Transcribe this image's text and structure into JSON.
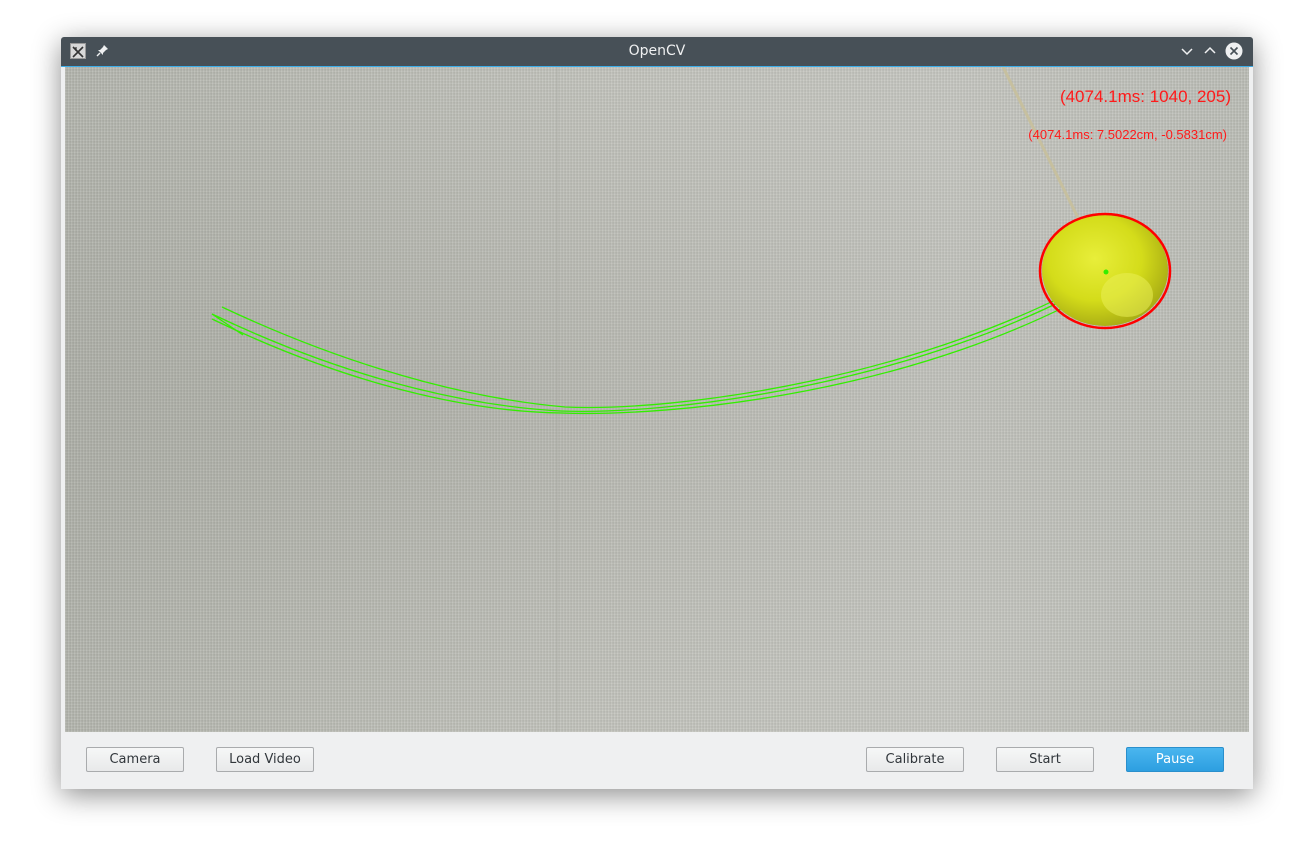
{
  "window": {
    "title": "OpenCV"
  },
  "titlebar": {
    "icons": [
      "app-icon",
      "pin-icon",
      "minimize-chevron-icon",
      "maximize-chevron-icon",
      "close-icon"
    ]
  },
  "overlay": {
    "pixel_readout": "(4074.1ms: 1040, 205)",
    "cm_readout": "(4074.1ms: 7.5022cm, -0.5831cm)",
    "text_color": "#ff1a1a",
    "trajectory_color": "#33ee00",
    "detection_circle_color": "#ff0000",
    "ball_color": "#d4dc1a"
  },
  "controls": {
    "camera_label": "Camera",
    "load_video_label": "Load Video",
    "calibrate_label": "Calibrate",
    "start_label": "Start",
    "pause_label": "Pause"
  },
  "colors": {
    "titlebar": "#475057",
    "accent": "#3daee9",
    "window_bg": "#eff0f1"
  }
}
